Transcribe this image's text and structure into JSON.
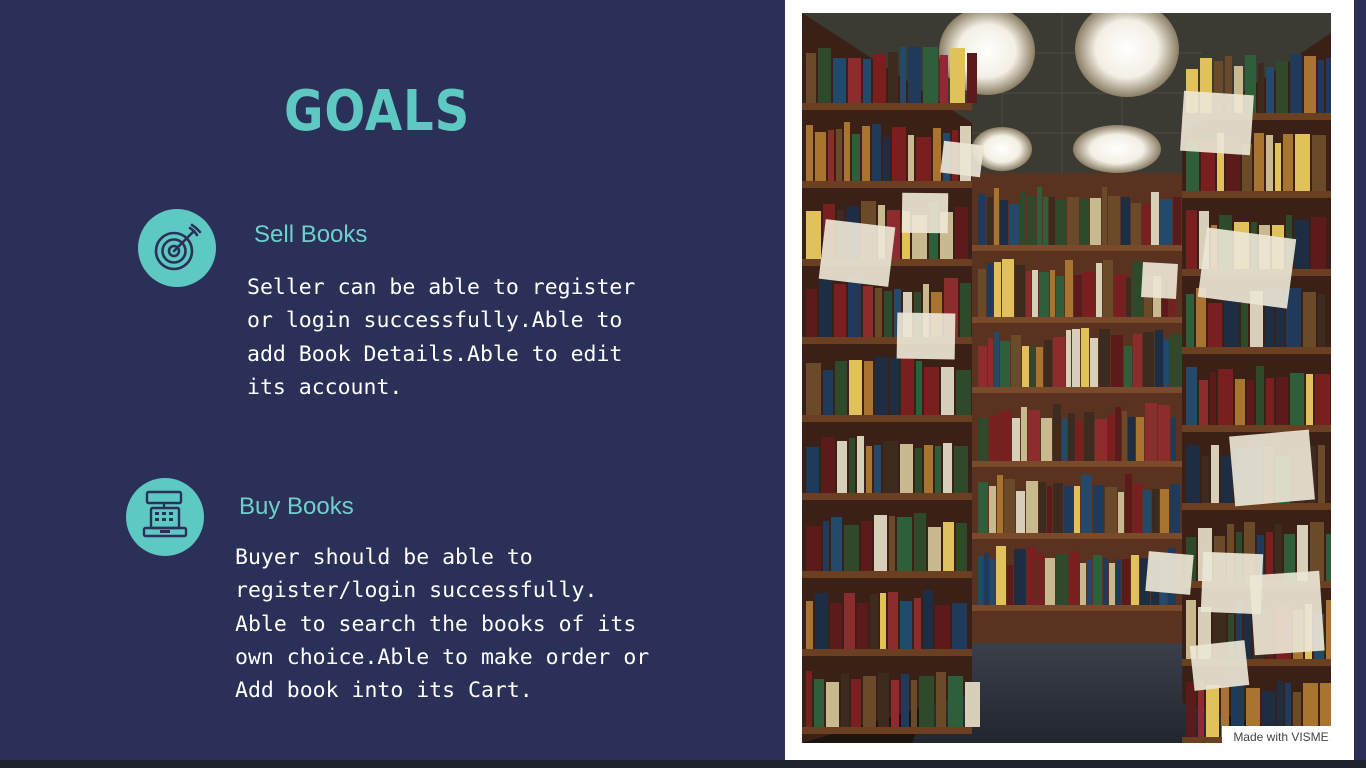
{
  "slide": {
    "title": "GOALS",
    "goals": [
      {
        "icon": "target-dart-icon",
        "heading": "Sell Books",
        "body": "Seller can be able to register\nor login successfully.Able to\nadd Book Details.Able to edit\nits account."
      },
      {
        "icon": "cash-register-icon",
        "heading": "Buy Books",
        "body": "Buyer should be able to\nregister/login successfully.\nAble to search the books of its\nown choice.Able to make order or\nAdd book into its Cart."
      }
    ]
  },
  "badge": {
    "label": "Made with VISME"
  },
  "colors": {
    "background": "#2a3057",
    "accent": "#5ec8c2",
    "text": "#ffffff",
    "panel": "#ffffff"
  }
}
